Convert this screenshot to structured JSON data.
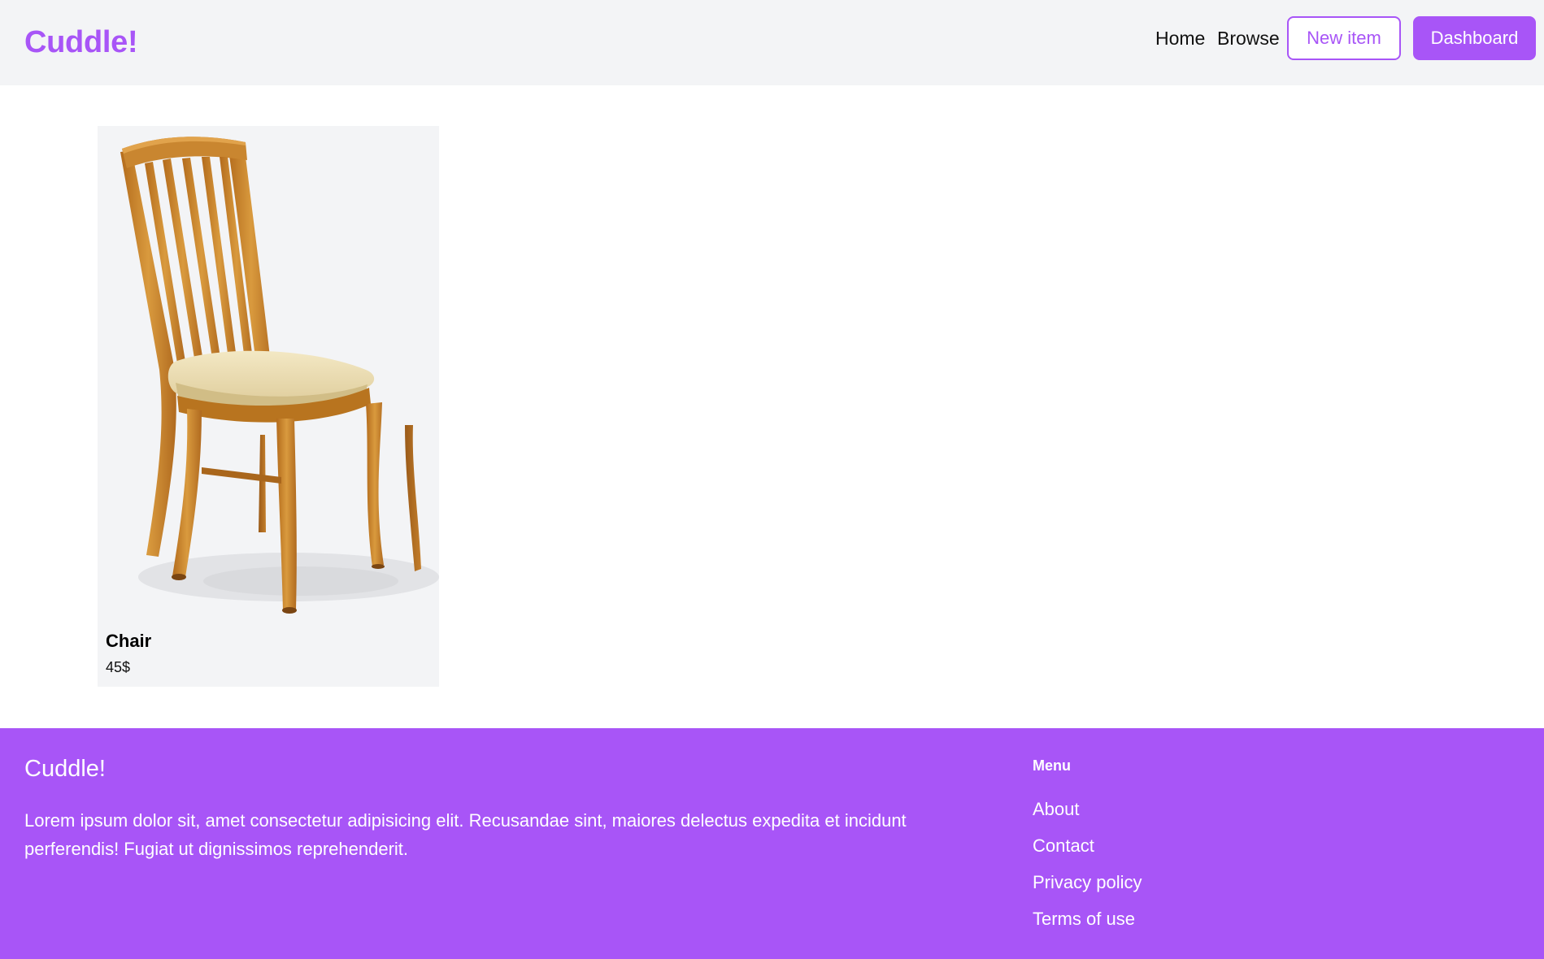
{
  "header": {
    "brand": "Cuddle!",
    "nav": {
      "home": "Home",
      "browse": "Browse"
    },
    "buttons": {
      "new_item": "New item",
      "dashboard": "Dashboard"
    }
  },
  "colors": {
    "accent": "#a855f7",
    "header_bg": "#f3f4f6",
    "card_bg": "#f3f4f6"
  },
  "products": [
    {
      "image": "wooden-chair-photo",
      "name": "Chair",
      "price": "45$"
    }
  ],
  "footer": {
    "brand": "Cuddle!",
    "description": "Lorem ipsum dolor sit, amet consectetur adipisicing elit. Recusandae sint, maiores delectus expedita et incidunt perferendis! Fugiat ut dignissimos reprehenderit.",
    "menu_title": "Menu",
    "menu_links": [
      "About",
      "Contact",
      "Privacy policy",
      "Terms of use"
    ]
  }
}
